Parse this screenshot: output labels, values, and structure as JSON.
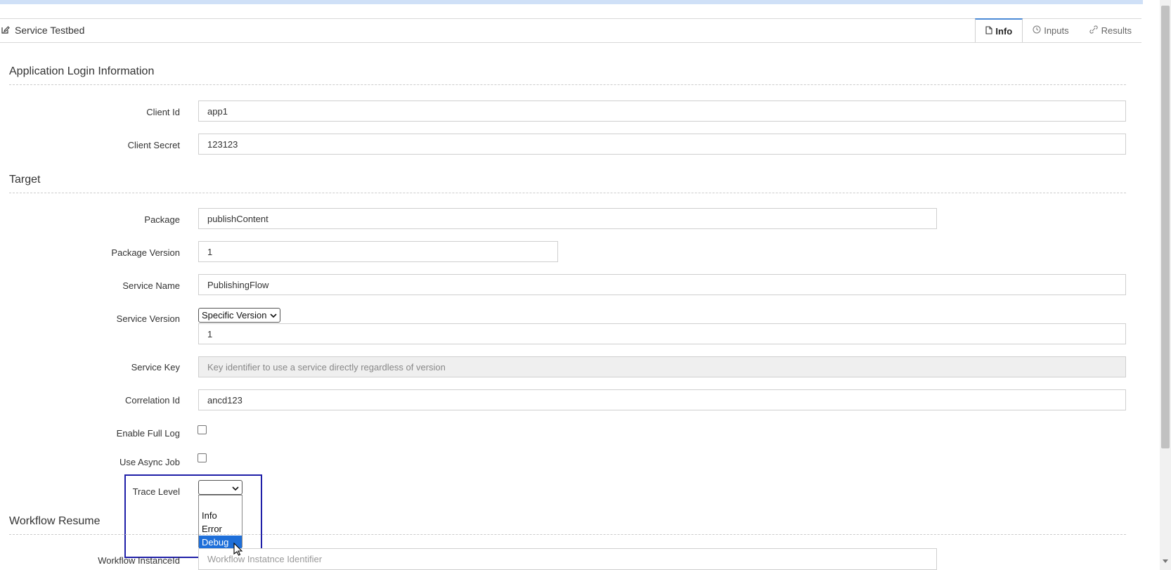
{
  "panel": {
    "title": "Service Testbed",
    "tabs": [
      {
        "label": "Info",
        "active": true
      },
      {
        "label": "Inputs",
        "active": false
      },
      {
        "label": "Results",
        "active": false
      }
    ]
  },
  "sections": {
    "app_login": "Application Login Information",
    "target": "Target",
    "workflow_resume": "Workflow Resume"
  },
  "fields": {
    "client_id": {
      "label": "Client Id",
      "value": "app1"
    },
    "client_secret": {
      "label": "Client Secret",
      "value": "123123"
    },
    "package": {
      "label": "Package",
      "value": "publishContent"
    },
    "package_version": {
      "label": "Package Version",
      "value": "1"
    },
    "service_name": {
      "label": "Service Name",
      "value": "PublishingFlow"
    },
    "service_version": {
      "label": "Service Version",
      "select_value": "Specific Version",
      "value": "1"
    },
    "service_key": {
      "label": "Service Key",
      "placeholder": "Key identifier to use a service directly regardless of version"
    },
    "correlation_id": {
      "label": "Correlation Id",
      "value": "ancd123"
    },
    "enable_full_log": {
      "label": "Enable Full Log",
      "checked": false
    },
    "use_async_job": {
      "label": "Use Async Job",
      "checked": false
    },
    "trace_level": {
      "label": "Trace Level",
      "value": "",
      "options": [
        "",
        "Info",
        "Error",
        "Debug"
      ],
      "highlighted": "Debug"
    },
    "workflow_instance_id": {
      "label": "Workflow InstanceId",
      "placeholder": "Workflow Instatnce Identifier"
    }
  },
  "colors": {
    "accent": "#4c8bd6",
    "selected_option": "#1e6fd9",
    "focus_box": "#1f1fa8"
  },
  "icons": {
    "title": "edit-icon",
    "info": "file-icon",
    "inputs": "clock-icon",
    "results": "link-icon"
  }
}
